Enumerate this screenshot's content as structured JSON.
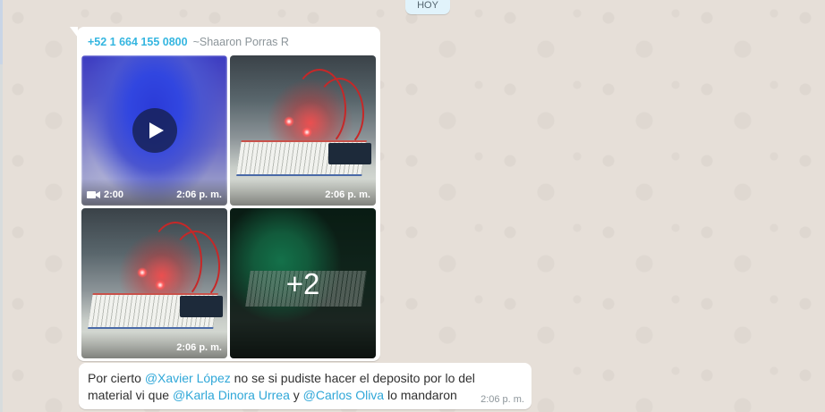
{
  "chat": {
    "day_label": "HOY",
    "album": {
      "sender_phone": "+52 1 664 155 0800",
      "sender_name": "~Shaaron Porras R",
      "tiles": [
        {
          "kind": "video",
          "duration": "2:00",
          "time": "2:06 p. m."
        },
        {
          "kind": "photo",
          "time": "2:06 p. m."
        },
        {
          "kind": "photo",
          "time": "2:06 p. m."
        },
        {
          "kind": "more",
          "more_count": "+2"
        }
      ]
    },
    "message": {
      "text_1": "Por cierto ",
      "mention_1": "@Xavier López",
      "text_2": " no se si pudiste hacer el deposito por lo del material vi que ",
      "mention_2": "@Karla Dinora Urrea",
      "text_3": " y ",
      "mention_3": "@Carlos Oliva",
      "text_4": " lo mandaron",
      "time": "2:06 p. m."
    }
  },
  "colors": {
    "wallpaper": "#e6dfd8",
    "bubble": "#ffffff",
    "mention": "#2fa7d8",
    "sender_phone": "#35b6e0",
    "meta_text": "#8c959a"
  },
  "icons": [
    "video-camera-icon",
    "play-icon"
  ]
}
